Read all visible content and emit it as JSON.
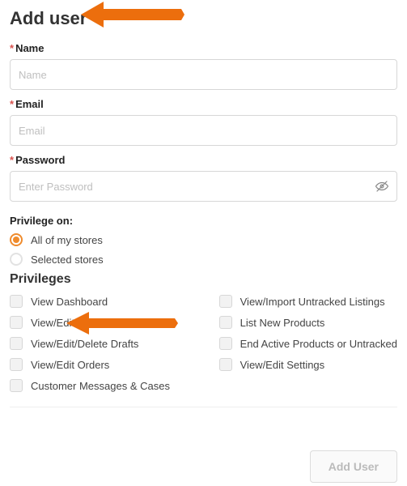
{
  "page_title": "Add user",
  "fields": {
    "name": {
      "label": "Name",
      "placeholder": "Name",
      "required": true,
      "value": ""
    },
    "email": {
      "label": "Email",
      "placeholder": "Email",
      "required": true,
      "value": ""
    },
    "password": {
      "label": "Password",
      "placeholder": "Enter Password",
      "required": true,
      "value": ""
    }
  },
  "privilege_on": {
    "label": "Privilege on:",
    "options": [
      {
        "label": "All of my stores",
        "selected": true
      },
      {
        "label": "Selected stores",
        "selected": false
      }
    ]
  },
  "privileges_heading": "Privileges",
  "privileges": {
    "left": [
      {
        "label": "View Dashboard",
        "checked": false
      },
      {
        "label": "View/Edit Active Products",
        "checked": false
      },
      {
        "label": "View/Edit/Delete Drafts",
        "checked": false
      },
      {
        "label": "View/Edit Orders",
        "checked": false
      },
      {
        "label": "Customer Messages & Cases",
        "checked": false
      }
    ],
    "right": [
      {
        "label": "View/Import Untracked Listings",
        "checked": false
      },
      {
        "label": "List New Products",
        "checked": false
      },
      {
        "label": "End Active Products or Untracked",
        "checked": false
      },
      {
        "label": "View/Edit Settings",
        "checked": false
      }
    ]
  },
  "add_user_button": {
    "label": "Add User",
    "enabled": false
  },
  "colors": {
    "accent": "#ef8b2d",
    "required": "#d9534f",
    "arrow": "#ec6e0d"
  }
}
